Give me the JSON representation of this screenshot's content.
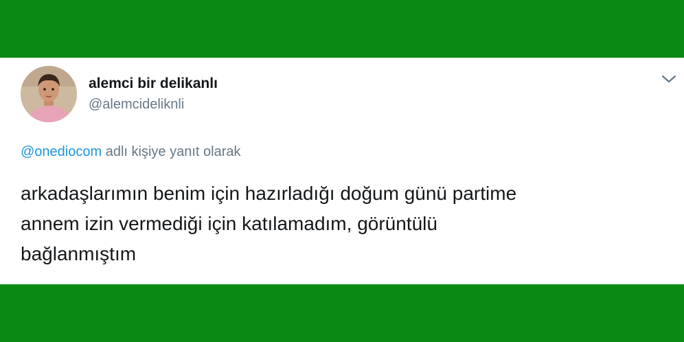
{
  "tweet": {
    "display_name": "alemci bir delikanlı",
    "handle": "@alemcideliknli",
    "reply_mention": "@onediocom",
    "reply_suffix": " adlı kişiye yanıt olarak",
    "text_lines": [
      "arkadaşlarımın benim için hazırladığı doğum günü partime",
      "annem izin vermediği için katılamadım, görüntülü",
      "bağlanmıştım"
    ]
  },
  "icons": {
    "menu": "chevron-down-icon",
    "avatar": "child-avatar"
  },
  "colors": {
    "frame": "#0b8a12",
    "mention": "#1b95e0",
    "secondary_text": "#657786",
    "primary_text": "#14171a"
  }
}
